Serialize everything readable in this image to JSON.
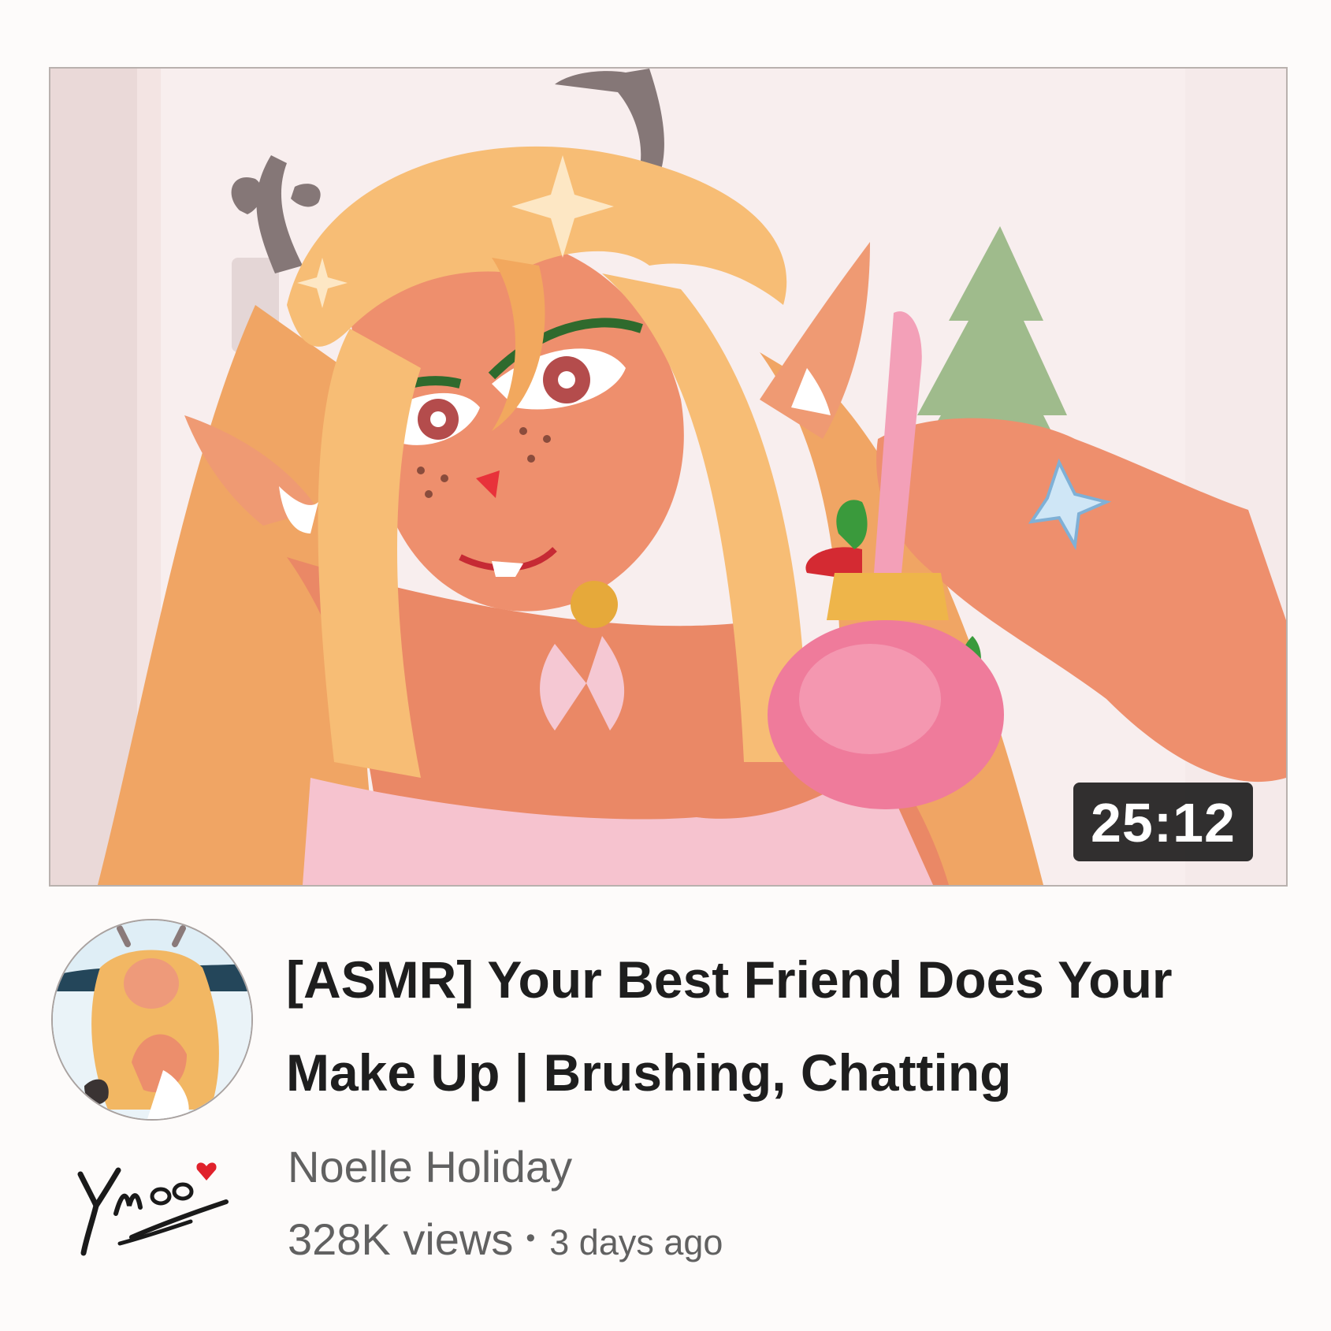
{
  "video": {
    "duration": "25:12",
    "title": "[ASMR] Your Best Friend Does Your Make Up  |  Brushing, Chatting",
    "channel": "Noelle Holiday",
    "views": "328K views",
    "separator": "•",
    "age": "3 days ago"
  },
  "thumbnail": {
    "subject": "anime deer girl holding a pink makeup brush",
    "icon": "video-thumbnail"
  },
  "avatar": {
    "icon": "channel-avatar"
  },
  "signature": {
    "icon": "artist-signature",
    "text": "YMoo"
  },
  "colors": {
    "title": "#1e1e1e",
    "secondary_text": "#616161",
    "duration_bg": "#141414",
    "hair": "#f5b96b",
    "skin": "#ec8e6c",
    "brush_pink": "#ef7b9b"
  }
}
